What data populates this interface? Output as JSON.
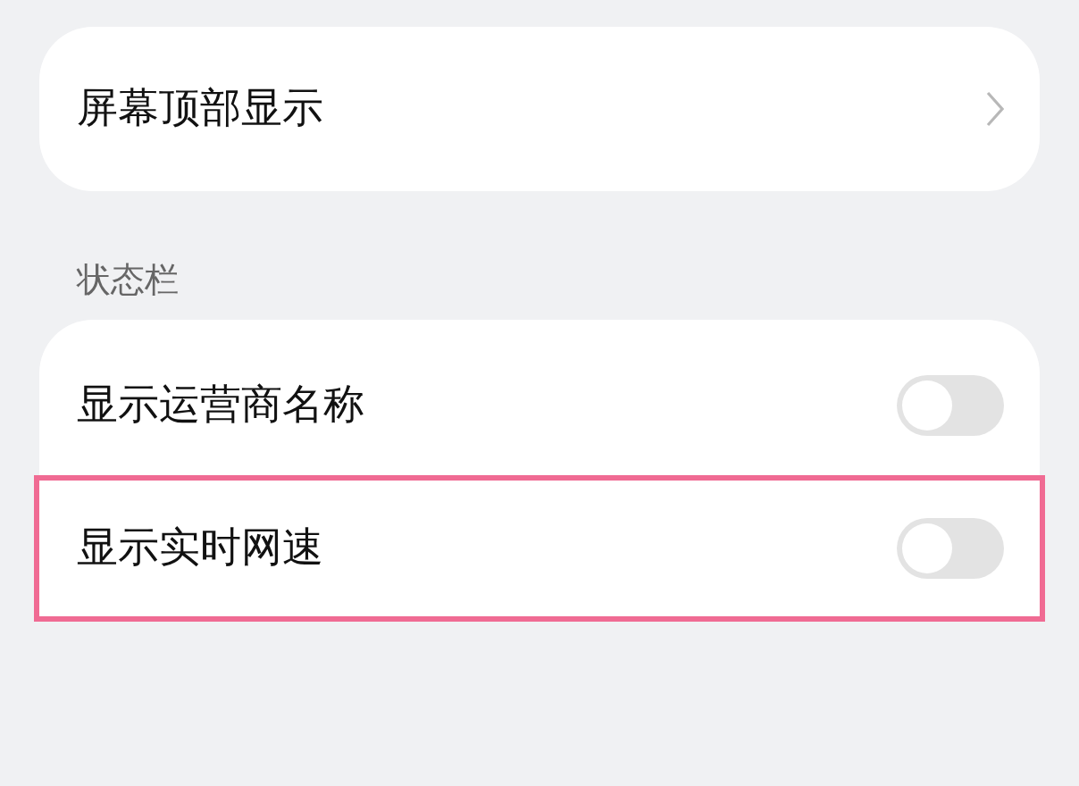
{
  "top_card": {
    "label": "屏幕顶部显示"
  },
  "status_bar_section": {
    "title": "状态栏",
    "items": [
      {
        "label": "显示运营商名称",
        "on": false,
        "highlighted": false
      },
      {
        "label": "显示实时网速",
        "on": false,
        "highlighted": true
      }
    ]
  }
}
